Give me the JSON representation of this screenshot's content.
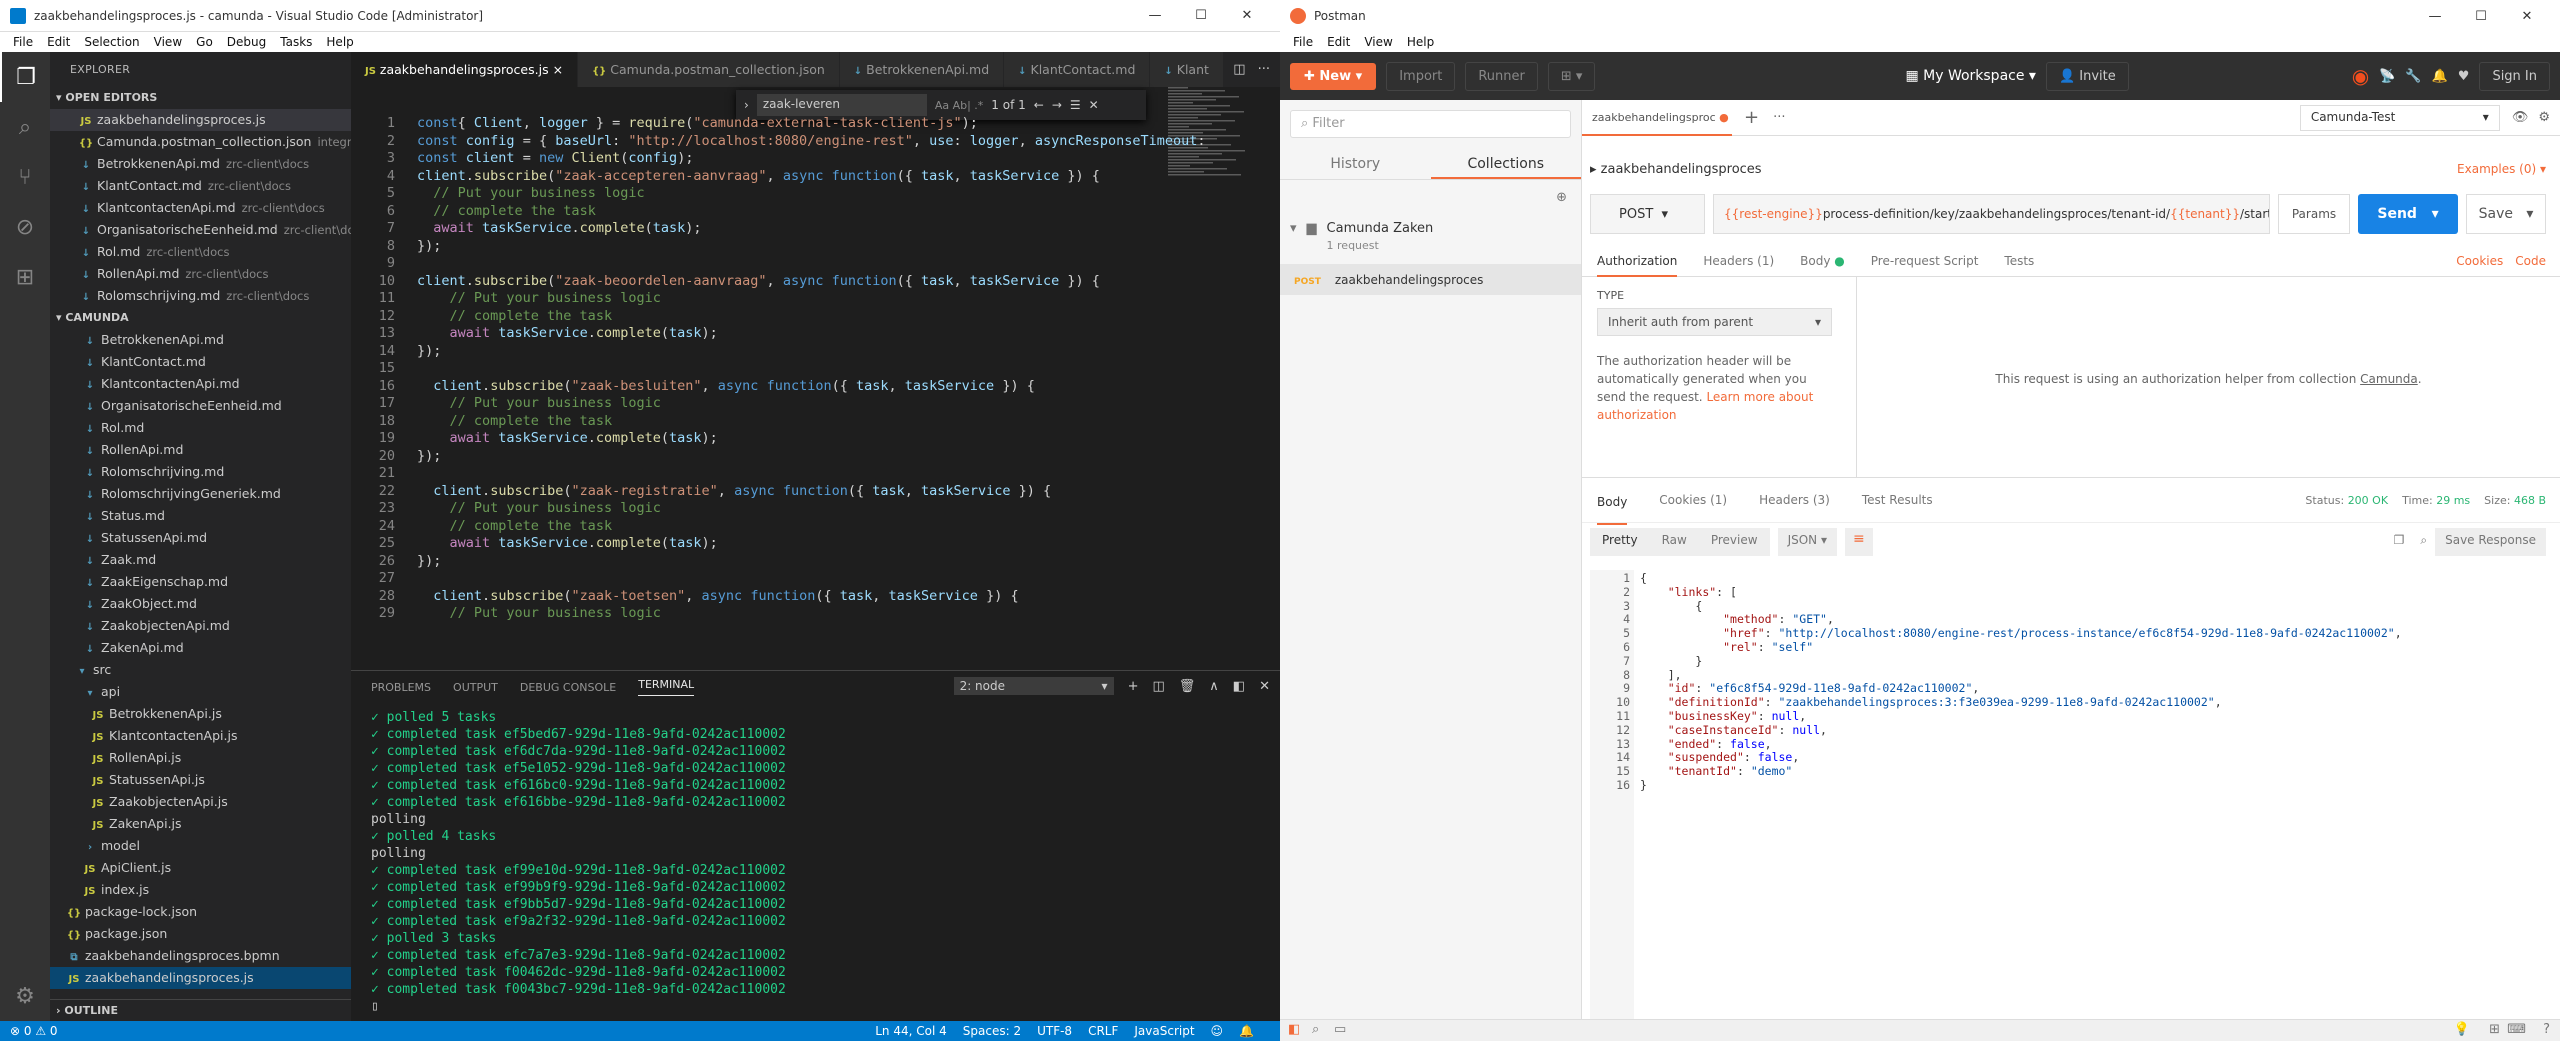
{
  "vscode": {
    "title": "zaakbehandelingsproces.js - camunda - Visual Studio Code [Administrator]",
    "menu": [
      "File",
      "Edit",
      "Selection",
      "View",
      "Go",
      "Debug",
      "Tasks",
      "Help"
    ],
    "explorer": "EXPLORER",
    "open_editors": "OPEN EDITORS",
    "open_files": [
      {
        "icon": "JS",
        "name": "zaakbehandelingsproces.js",
        "dim": ""
      },
      {
        "icon": "{}",
        "name": "Camunda.postman_collection.json",
        "dim": "integra..."
      },
      {
        "icon": "↓",
        "name": "BetrokkenenApi.md",
        "dim": "zrc-client\\docs"
      },
      {
        "icon": "↓",
        "name": "KlantContact.md",
        "dim": "zrc-client\\docs"
      },
      {
        "icon": "↓",
        "name": "KlantcontactenApi.md",
        "dim": "zrc-client\\docs"
      },
      {
        "icon": "↓",
        "name": "OrganisatorischeEenheid.md",
        "dim": "zrc-client\\do..."
      },
      {
        "icon": "↓",
        "name": "Rol.md",
        "dim": "zrc-client\\docs"
      },
      {
        "icon": "↓",
        "name": "RollenApi.md",
        "dim": "zrc-client\\docs"
      },
      {
        "icon": "↓",
        "name": "Rolomschrijving.md",
        "dim": "zrc-client\\docs"
      }
    ],
    "project": "CAMUNDA",
    "tree": [
      {
        "icon": "↓",
        "name": "BetrokkenenApi.md",
        "indent": 1
      },
      {
        "icon": "↓",
        "name": "KlantContact.md",
        "indent": 1
      },
      {
        "icon": "↓",
        "name": "KlantcontactenApi.md",
        "indent": 1
      },
      {
        "icon": "↓",
        "name": "OrganisatorischeEenheid.md",
        "indent": 1
      },
      {
        "icon": "↓",
        "name": "Rol.md",
        "indent": 1
      },
      {
        "icon": "↓",
        "name": "RollenApi.md",
        "indent": 1
      },
      {
        "icon": "↓",
        "name": "Rolomschrijving.md",
        "indent": 1
      },
      {
        "icon": "↓",
        "name": "RolomschrijvingGeneriek.md",
        "indent": 1
      },
      {
        "icon": "↓",
        "name": "Status.md",
        "indent": 1
      },
      {
        "icon": "↓",
        "name": "StatussenApi.md",
        "indent": 1
      },
      {
        "icon": "↓",
        "name": "Zaak.md",
        "indent": 1
      },
      {
        "icon": "↓",
        "name": "ZaakEigenschap.md",
        "indent": 1
      },
      {
        "icon": "↓",
        "name": "ZaakObject.md",
        "indent": 1
      },
      {
        "icon": "↓",
        "name": "ZaakobjectenApi.md",
        "indent": 1
      },
      {
        "icon": "↓",
        "name": "ZakenApi.md",
        "indent": 1
      },
      {
        "icon": "▾",
        "name": "src",
        "indent": 0.5
      },
      {
        "icon": "▾",
        "name": "api",
        "indent": 1
      },
      {
        "icon": "JS",
        "name": "BetrokkenenApi.js",
        "indent": 1.5
      },
      {
        "icon": "JS",
        "name": "KlantcontactenApi.js",
        "indent": 1.5
      },
      {
        "icon": "JS",
        "name": "RollenApi.js",
        "indent": 1.5
      },
      {
        "icon": "JS",
        "name": "StatussenApi.js",
        "indent": 1.5
      },
      {
        "icon": "JS",
        "name": "ZaakobjectenApi.js",
        "indent": 1.5
      },
      {
        "icon": "JS",
        "name": "ZakenApi.js",
        "indent": 1.5
      },
      {
        "icon": "›",
        "name": "model",
        "indent": 1
      },
      {
        "icon": "JS",
        "name": "ApiClient.js",
        "indent": 1
      },
      {
        "icon": "JS",
        "name": "index.js",
        "indent": 1
      },
      {
        "icon": "{}",
        "name": "package-lock.json",
        "indent": 0
      },
      {
        "icon": "{}",
        "name": "package.json",
        "indent": 0
      },
      {
        "icon": "⧉",
        "name": "zaakbehandelingsproces.bpmn",
        "indent": 0
      },
      {
        "icon": "JS",
        "name": "zaakbehandelingsproces.js",
        "indent": 0
      }
    ],
    "outline": "OUTLINE",
    "tabs": [
      {
        "icon": "JS",
        "name": "zaakbehandelingsproces.js",
        "close": "×"
      },
      {
        "icon": "{}",
        "name": "Camunda.postman_collection.json",
        "close": ""
      },
      {
        "icon": "↓",
        "name": "BetrokkenenApi.md",
        "close": ""
      },
      {
        "icon": "↓",
        "name": "KlantContact.md",
        "close": ""
      },
      {
        "icon": "↓",
        "name": "Klant",
        "close": ""
      }
    ],
    "find": {
      "value": "zaak-leveren",
      "count": "1 of 1",
      "opts": "Aa  Ab|  .*"
    },
    "panel_tabs": [
      "PROBLEMS",
      "OUTPUT",
      "DEBUG CONSOLE",
      "TERMINAL"
    ],
    "terminal_select": "2: node",
    "terminal": [
      "✓ polled 5 tasks",
      "✓ completed task ef5bed67-929d-11e8-9afd-0242ac110002",
      "✓ completed task ef6dc7da-929d-11e8-9afd-0242ac110002",
      "✓ completed task ef5e1052-929d-11e8-9afd-0242ac110002",
      "✓ completed task ef616bc0-929d-11e8-9afd-0242ac110002",
      "✓ completed task ef616bbe-929d-11e8-9afd-0242ac110002",
      "polling",
      "✓ polled 4 tasks",
      "polling",
      "✓ completed task ef99e10d-929d-11e8-9afd-0242ac110002",
      "✓ completed task ef99b9f9-929d-11e8-9afd-0242ac110002",
      "✓ completed task ef9bb5d7-929d-11e8-9afd-0242ac110002",
      "✓ completed task ef9a2f32-929d-11e8-9afd-0242ac110002",
      "✓ polled 3 tasks",
      "✓ completed task efc7a7e3-929d-11e8-9afd-0242ac110002",
      "✓ completed task f00462dc-929d-11e8-9afd-0242ac110002",
      "✓ completed task f0043bc7-929d-11e8-9afd-0242ac110002",
      "▯"
    ],
    "status": {
      "left": "⊗ 0  ⚠ 0",
      "pos": "Ln 44, Col 4",
      "spaces": "Spaces: 2",
      "enc": "UTF-8",
      "eol": "CRLF",
      "lang": "JavaScript",
      "smile": "☺",
      "bell": "🔔"
    }
  },
  "code_lines": [
    [
      [
        "kw",
        "const"
      ],
      [
        "",
        "{ "
      ],
      [
        "vr",
        "Client"
      ],
      [
        "",
        ", "
      ],
      [
        "vr",
        "logger"
      ],
      [
        "",
        " } = "
      ],
      [
        "fn",
        "require"
      ],
      [
        "",
        "("
      ],
      [
        "str",
        "\"camunda-external-task-client-js\""
      ],
      [
        "",
        ");"
      ]
    ],
    [
      [
        "kw",
        "const"
      ],
      [
        "",
        " "
      ],
      [
        "vr",
        "config"
      ],
      [
        "",
        " = { "
      ],
      [
        "vr",
        "baseUrl"
      ],
      [
        "",
        ": "
      ],
      [
        "str",
        "\"http://localhost:8080/engine-rest\""
      ],
      [
        "",
        ", "
      ],
      [
        "vr",
        "use"
      ],
      [
        "",
        ": "
      ],
      [
        "vr",
        "logger"
      ],
      [
        "",
        ", "
      ],
      [
        "vr",
        "asyncResponseTimeout"
      ],
      [
        "",
        ":"
      ]
    ],
    [
      [
        "kw",
        "const"
      ],
      [
        "",
        " "
      ],
      [
        "vr",
        "client"
      ],
      [
        "",
        " = "
      ],
      [
        "kw",
        "new"
      ],
      [
        "",
        " "
      ],
      [
        "fn",
        "Client"
      ],
      [
        "",
        "("
      ],
      [
        "vr",
        "config"
      ],
      [
        "",
        ");"
      ]
    ],
    [
      [
        "vr",
        "client"
      ],
      [
        "",
        "."
      ],
      [
        "fn",
        "subscribe"
      ],
      [
        "",
        "("
      ],
      [
        "str",
        "\"zaak-accepteren-aanvraag\""
      ],
      [
        "",
        ", "
      ],
      [
        "kw",
        "async"
      ],
      [
        "",
        " "
      ],
      [
        "kw",
        "function"
      ],
      [
        "",
        "({ "
      ],
      [
        "vr",
        "task"
      ],
      [
        "",
        ", "
      ],
      [
        "vr",
        "taskService"
      ],
      [
        "",
        " }) {"
      ]
    ],
    [
      [
        "",
        "  "
      ],
      [
        "cm",
        "// Put your business logic"
      ]
    ],
    [
      [
        "",
        "  "
      ],
      [
        "cm",
        "// complete the task"
      ]
    ],
    [
      [
        "",
        "  "
      ],
      [
        "ctl",
        "await"
      ],
      [
        "",
        " "
      ],
      [
        "vr",
        "taskService"
      ],
      [
        "",
        "."
      ],
      [
        "fn",
        "complete"
      ],
      [
        "",
        "("
      ],
      [
        "vr",
        "task"
      ],
      [
        "",
        ");"
      ]
    ],
    [
      [
        "",
        "});"
      ]
    ],
    [
      [
        "",
        ""
      ]
    ],
    [
      [
        "vr",
        "client"
      ],
      [
        "",
        "."
      ],
      [
        "fn",
        "subscribe"
      ],
      [
        "",
        "("
      ],
      [
        "str",
        "\"zaak-beoordelen-aanvraag\""
      ],
      [
        "",
        ", "
      ],
      [
        "kw",
        "async"
      ],
      [
        "",
        " "
      ],
      [
        "kw",
        "function"
      ],
      [
        "",
        "({ "
      ],
      [
        "vr",
        "task"
      ],
      [
        "",
        ", "
      ],
      [
        "vr",
        "taskService"
      ],
      [
        "",
        " }) {"
      ]
    ],
    [
      [
        "",
        "    "
      ],
      [
        "cm",
        "// Put your business logic"
      ]
    ],
    [
      [
        "",
        "    "
      ],
      [
        "cm",
        "// complete the task"
      ]
    ],
    [
      [
        "",
        "    "
      ],
      [
        "ctl",
        "await"
      ],
      [
        "",
        " "
      ],
      [
        "vr",
        "taskService"
      ],
      [
        "",
        "."
      ],
      [
        "fn",
        "complete"
      ],
      [
        "",
        "("
      ],
      [
        "vr",
        "task"
      ],
      [
        "",
        ");"
      ]
    ],
    [
      [
        "",
        "});"
      ]
    ],
    [
      [
        "",
        ""
      ]
    ],
    [
      [
        "",
        "  "
      ],
      [
        "vr",
        "client"
      ],
      [
        "",
        "."
      ],
      [
        "fn",
        "subscribe"
      ],
      [
        "",
        "("
      ],
      [
        "str",
        "\"zaak-besluiten\""
      ],
      [
        "",
        ", "
      ],
      [
        "kw",
        "async"
      ],
      [
        "",
        " "
      ],
      [
        "kw",
        "function"
      ],
      [
        "",
        "({ "
      ],
      [
        "vr",
        "task"
      ],
      [
        "",
        ", "
      ],
      [
        "vr",
        "taskService"
      ],
      [
        "",
        " }) {"
      ]
    ],
    [
      [
        "",
        "    "
      ],
      [
        "cm",
        "// Put your business logic"
      ]
    ],
    [
      [
        "",
        "    "
      ],
      [
        "cm",
        "// complete the task"
      ]
    ],
    [
      [
        "",
        "    "
      ],
      [
        "ctl",
        "await"
      ],
      [
        "",
        " "
      ],
      [
        "vr",
        "taskService"
      ],
      [
        "",
        "."
      ],
      [
        "fn",
        "complete"
      ],
      [
        "",
        "("
      ],
      [
        "vr",
        "task"
      ],
      [
        "",
        ");"
      ]
    ],
    [
      [
        "",
        "});"
      ]
    ],
    [
      [
        "",
        ""
      ]
    ],
    [
      [
        "",
        "  "
      ],
      [
        "vr",
        "client"
      ],
      [
        "",
        "."
      ],
      [
        "fn",
        "subscribe"
      ],
      [
        "",
        "("
      ],
      [
        "str",
        "\"zaak-registratie\""
      ],
      [
        "",
        ", "
      ],
      [
        "kw",
        "async"
      ],
      [
        "",
        " "
      ],
      [
        "kw",
        "function"
      ],
      [
        "",
        "({ "
      ],
      [
        "vr",
        "task"
      ],
      [
        "",
        ", "
      ],
      [
        "vr",
        "taskService"
      ],
      [
        "",
        " }) {"
      ]
    ],
    [
      [
        "",
        "    "
      ],
      [
        "cm",
        "// Put your business logic"
      ]
    ],
    [
      [
        "",
        "    "
      ],
      [
        "cm",
        "// complete the task"
      ]
    ],
    [
      [
        "",
        "    "
      ],
      [
        "ctl",
        "await"
      ],
      [
        "",
        " "
      ],
      [
        "vr",
        "taskService"
      ],
      [
        "",
        "."
      ],
      [
        "fn",
        "complete"
      ],
      [
        "",
        "("
      ],
      [
        "vr",
        "task"
      ],
      [
        "",
        ");"
      ]
    ],
    [
      [
        "",
        "});"
      ]
    ],
    [
      [
        "",
        ""
      ]
    ],
    [
      [
        "",
        "  "
      ],
      [
        "vr",
        "client"
      ],
      [
        "",
        "."
      ],
      [
        "fn",
        "subscribe"
      ],
      [
        "",
        "("
      ],
      [
        "str",
        "\"zaak-toetsen\""
      ],
      [
        "",
        ", "
      ],
      [
        "kw",
        "async"
      ],
      [
        "",
        " "
      ],
      [
        "kw",
        "function"
      ],
      [
        "",
        "({ "
      ],
      [
        "vr",
        "task"
      ],
      [
        "",
        ", "
      ],
      [
        "vr",
        "taskService"
      ],
      [
        "",
        " }) {"
      ]
    ],
    [
      [
        "",
        "    "
      ],
      [
        "cm",
        "// Put your business logic"
      ]
    ]
  ],
  "postman": {
    "title": "Postman",
    "menu": [
      "File",
      "Edit",
      "View",
      "Help"
    ],
    "new": "New",
    "import": "Import",
    "runner": "Runner",
    "workspace": "My Workspace",
    "invite": "Invite",
    "signin": "Sign In",
    "filter": "Filter",
    "history": "History",
    "collections": "Collections",
    "collection_name": "Camunda Zaken",
    "collection_count": "1 request",
    "req_method": "POST",
    "req_name": "zaakbehandelingsproces",
    "tab": "zaakbehandelingsproc",
    "env": "Camunda-Test",
    "crumb": "zaakbehandelingsproces",
    "examples": "Examples (0)",
    "method": "POST",
    "url_parts": [
      [
        "v",
        "{{rest-engine}}"
      ],
      [
        "t",
        "process-definition/key/zaakbehandelingsproces/tenant-id/"
      ],
      [
        "v",
        "{{tenant}}"
      ],
      [
        "t",
        "/start"
      ]
    ],
    "params": "Params",
    "send": "Send",
    "save": "Save",
    "req_tabs": [
      "Authorization",
      "Headers (1)",
      "Body",
      "Pre-request Script",
      "Tests"
    ],
    "cookies": "Cookies",
    "code": "Code",
    "type_label": "TYPE",
    "auth_type": "Inherit auth from parent",
    "auth_note": "The authorization header will be automatically generated when you send the request.",
    "learn": "Learn more about authorization",
    "helper": "This request is using an authorization helper from collection",
    "helper_link": "Camunda",
    "resp_tabs": [
      "Body",
      "Cookies (1)",
      "Headers (3)",
      "Test Results"
    ],
    "status_label": "Status:",
    "status": "200 OK",
    "time_label": "Time:",
    "time": "29 ms",
    "size_label": "Size:",
    "size": "468 B",
    "views": [
      "Pretty",
      "Raw",
      "Preview"
    ],
    "format": "JSON",
    "save_resp": "Save Response",
    "json_lines": [
      "{",
      "    \"links\": [",
      "        {",
      "            \"method\": \"GET\",",
      "            \"href\": \"http://localhost:8080/engine-rest/process-instance/ef6c8f54-929d-11e8-9afd-0242ac110002\",",
      "            \"rel\": \"self\"",
      "        }",
      "    ],",
      "    \"id\": \"ef6c8f54-929d-11e8-9afd-0242ac110002\",",
      "    \"definitionId\": \"zaakbehandelingsproces:3:f3e039ea-9299-11e8-9afd-0242ac110002\",",
      "    \"businessKey\": null,",
      "    \"caseInstanceId\": null,",
      "    \"ended\": false,",
      "    \"suspended\": false,",
      "    \"tenantId\": \"demo\"",
      "}"
    ]
  }
}
